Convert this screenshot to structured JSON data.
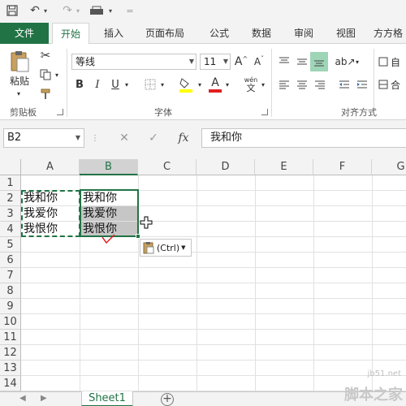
{
  "tabs": [
    "文件",
    "开始",
    "插入",
    "页面布局",
    "公式",
    "数据",
    "审阅",
    "视图",
    "方方格"
  ],
  "ribbon": {
    "paste_label": "粘贴",
    "font_name": "等线",
    "font_size": "11",
    "grow_font": "A",
    "shrink_font": "A",
    "bold": "B",
    "italic": "I",
    "underline": "U",
    "font_color": "A",
    "phonetic": "wén",
    "groups": {
      "clipboard": "剪贴板",
      "font": "字体",
      "alignment": "对齐方式"
    },
    "auto_label": "自",
    "merge_label": "合"
  },
  "formula_bar": {
    "name_box": "B2",
    "fx": "fx",
    "content": "我和你"
  },
  "grid": {
    "columns": [
      "A",
      "B",
      "C",
      "D",
      "E",
      "F",
      "G"
    ],
    "selected_column": "B",
    "rows": [
      "1",
      "2",
      "3",
      "4",
      "5",
      "6",
      "7",
      "8",
      "9",
      "10",
      "11",
      "12",
      "13",
      "14"
    ],
    "cells": {
      "A2": "我和你",
      "A3": "我爱你",
      "A4": "我恨你",
      "B2": "我和你",
      "B3": "我爱你",
      "B4": "我恨你"
    },
    "paste_options": "(Ctrl)"
  },
  "sheets": [
    "Sheet1"
  ],
  "watermark": {
    "url": "jb51.net",
    "text": "脚本之家"
  },
  "colors": {
    "accent": "#217346",
    "selection": "#c6c6c6",
    "annotation": "#e02020"
  }
}
